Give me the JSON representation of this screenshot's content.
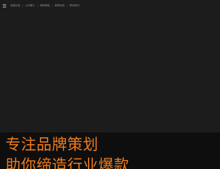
{
  "nav": {
    "items": [
      "诚信标准",
      "公司简介",
      "案例精选",
      "新闻动态",
      "联系我们"
    ],
    "separator": "|"
  },
  "banner": {
    "line1": "专注品牌策划",
    "line2": "助你缔造行业爆款"
  },
  "colors": {
    "accent": "#f07b1c",
    "background": "#1c1c1c",
    "banner_bg": "#0e0e0e"
  },
  "icons": {
    "menu": "hamburger-menu-icon"
  }
}
